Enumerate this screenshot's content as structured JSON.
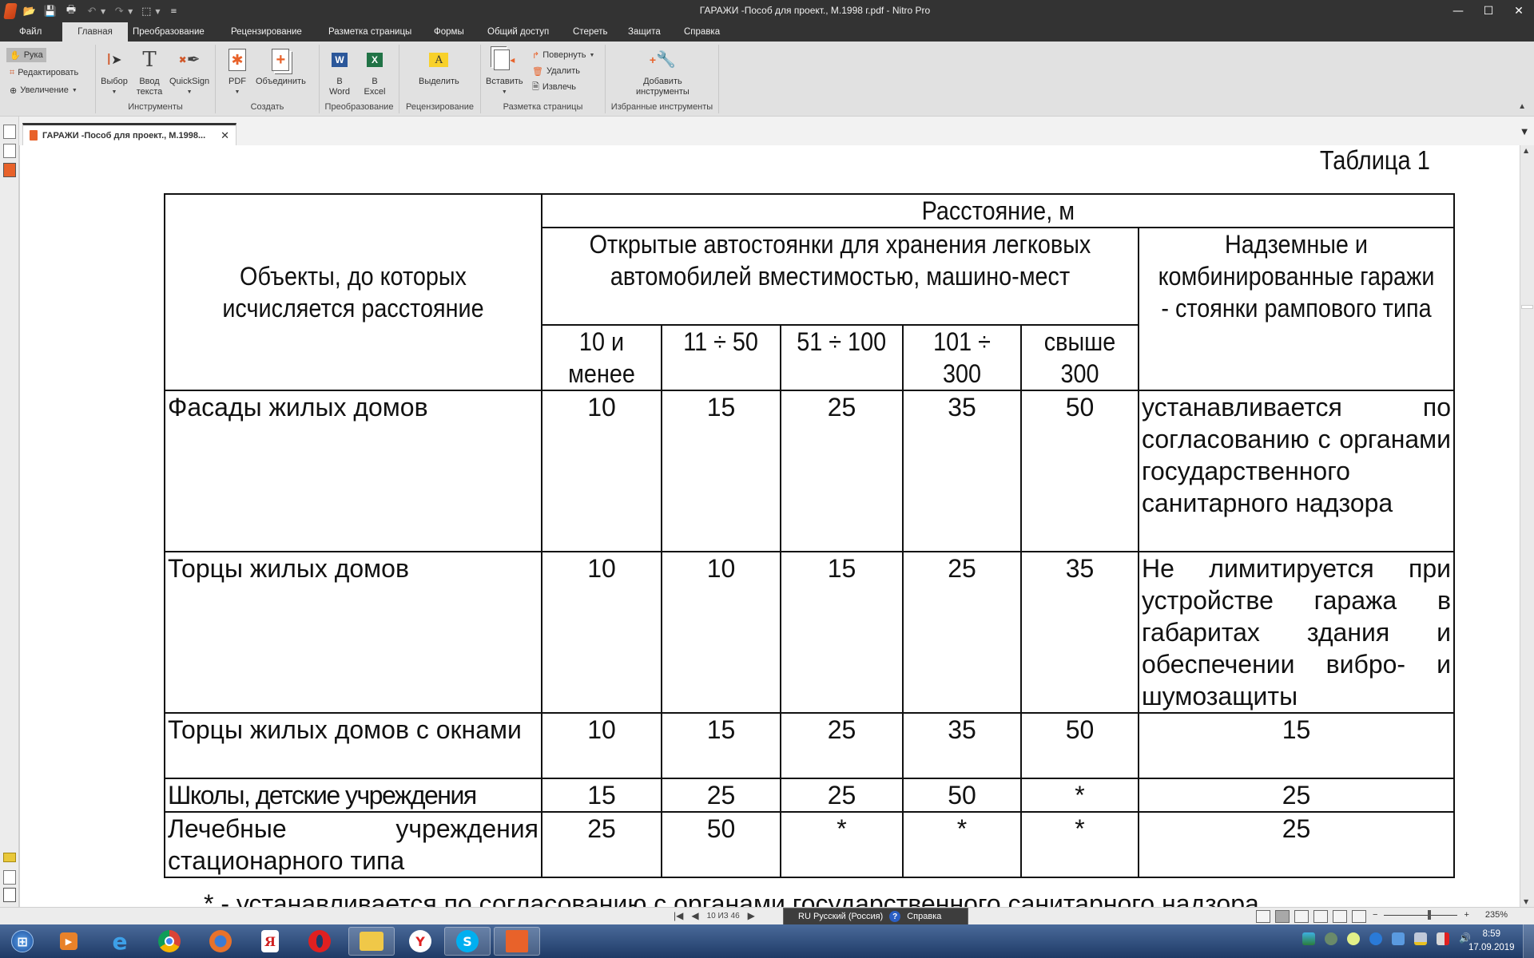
{
  "window": {
    "title": "ГАРАЖИ -Пособ для проект., М.1998 г.pdf - Nitro Pro",
    "controls": {
      "minimize": "—",
      "maximize": "☐",
      "close": "✕"
    }
  },
  "quick_access": [
    "open-folder",
    "save",
    "print",
    "undo",
    "redo",
    "select",
    "customize"
  ],
  "menu_tabs": [
    {
      "label": "Файл",
      "active": false
    },
    {
      "label": "Главная",
      "active": true
    },
    {
      "label": "Преобразование",
      "active": false
    },
    {
      "label": "Рецензирование",
      "active": false
    },
    {
      "label": "Разметка страницы",
      "active": false
    },
    {
      "label": "Формы",
      "active": false
    },
    {
      "label": "Общий доступ",
      "active": false
    },
    {
      "label": "Стереть",
      "active": false
    },
    {
      "label": "Защита",
      "active": false
    },
    {
      "label": "Справка",
      "active": false
    }
  ],
  "ribbon": {
    "modes": {
      "hand": "Рука",
      "edit": "Редактировать",
      "zoom": "Увеличение"
    },
    "tools": {
      "select": "Выбор",
      "type_text_1": "Ввод",
      "type_text_2": "текста",
      "quicksign": "QuickSign",
      "group": "Инструменты"
    },
    "create": {
      "pdf": "PDF",
      "combine": "Объединить",
      "group": "Создать"
    },
    "convert": {
      "word_1": "В",
      "word_2": "Word",
      "excel_1": "В",
      "excel_2": "Excel",
      "group": "Преобразование"
    },
    "review": {
      "highlight": "Выделить",
      "group": "Рецензирование"
    },
    "page_layout": {
      "insert": "Вставить",
      "rotate": "Повернуть",
      "delete": "Удалить",
      "extract": "Извлечь",
      "group": "Разметка страницы"
    },
    "favorites": {
      "add_1": "Добавить",
      "add_2": "инструменты",
      "group": "Избранные инструменты"
    }
  },
  "doc_tab": {
    "label": "ГАРАЖИ -Пособ для проект., М.1998..."
  },
  "document": {
    "caption": "Таблица 1",
    "header": {
      "objects": "Объекты, до которых исчисляется расстояние",
      "distance": "Расстояние, м",
      "open_parking": "Открытые автостоянки для хранения легковых автомобилей вместимостью, машино-мест",
      "garages": "Надземные и комбинированные гаражи - стоянки рампового типа",
      "capacity": [
        "10 и менее",
        "11 ÷ 50",
        "51 ÷ 100",
        "101 ÷ 300",
        "свыше 300"
      ]
    },
    "rows": [
      {
        "object": "Фасады жилых домов",
        "values": [
          "10",
          "15",
          "25",
          "35",
          "50"
        ],
        "garages": "устанавливается по согласованию с органами государственного санитарного надзора"
      },
      {
        "object": "Торцы жилых домов",
        "values": [
          "10",
          "10",
          "15",
          "25",
          "35"
        ],
        "garages": "Не лимитируется при устройстве гаража в габаритах здания и обеспечении вибро- и шумозащиты"
      },
      {
        "object": "Торцы жилых домов с окнами",
        "values": [
          "10",
          "15",
          "25",
          "35",
          "50"
        ],
        "garages": "15"
      },
      {
        "object": "Школы, детские учреждения",
        "values": [
          "15",
          "25",
          "25",
          "50",
          "*"
        ],
        "garages": "25"
      },
      {
        "object": "Лечебные учреждения стационарного типа",
        "values": [
          "25",
          "50",
          "*",
          "*",
          "*"
        ],
        "garages": "25"
      }
    ],
    "footnote": "* - устанавливается по согласованию с органами государственного санитарного надзора"
  },
  "statusbar": {
    "page_indicator": "10 ИЗ 46",
    "language": "RU Русский (Россия)",
    "help": "Справка",
    "zoom_percent": "235%",
    "zoom_slider_fraction": 0.62,
    "zoom_minus": "−",
    "zoom_plus": "+"
  },
  "taskbar": {
    "apps": [
      "start",
      "media-player",
      "internet-explorer",
      "chrome",
      "firefox",
      "yandex",
      "opera",
      "file-explorer",
      "yandex-browser",
      "skype",
      "nitro-pro"
    ],
    "clock_time": "8:59",
    "clock_date": "17.09.2019"
  }
}
